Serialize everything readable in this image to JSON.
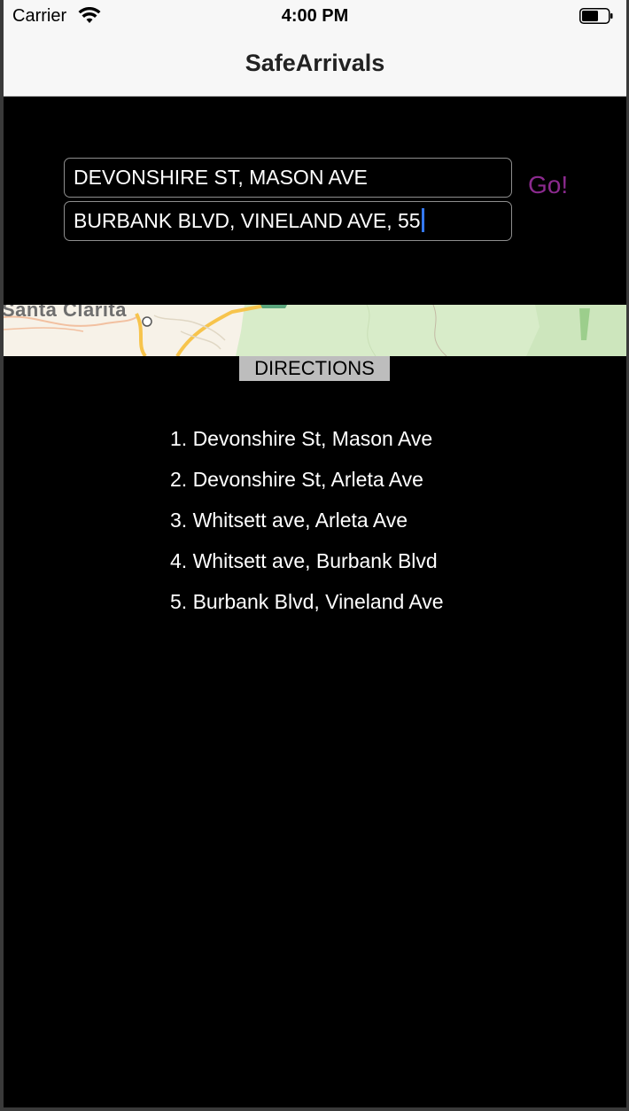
{
  "status_bar": {
    "carrier": "Carrier",
    "time": "4:00 PM",
    "icons": [
      "wifi-icon",
      "battery-icon"
    ]
  },
  "nav": {
    "title": "SafeArrivals"
  },
  "form": {
    "origin_value": "DEVONSHIRE ST, MASON AVE",
    "destination_value": "BURBANK BLVD, VINELAND AVE, 55",
    "go_label": "Go!"
  },
  "map": {
    "label": "Santa Clarita"
  },
  "directions": {
    "header": "DIRECTIONS",
    "steps": [
      "1. Devonshire St, Mason Ave",
      "2. Devonshire St, Arleta Ave",
      "3. Whitsett ave, Arleta Ave",
      "4. Whitsett ave, Burbank Blvd",
      "5. Burbank Blvd, Vineland Ave"
    ]
  },
  "colors": {
    "background": "#000000",
    "nav_background": "#f7f7f7",
    "go_button": "#8b2a8e",
    "caret": "#3478f6",
    "directions_header_bg": "#bdbdbd"
  }
}
